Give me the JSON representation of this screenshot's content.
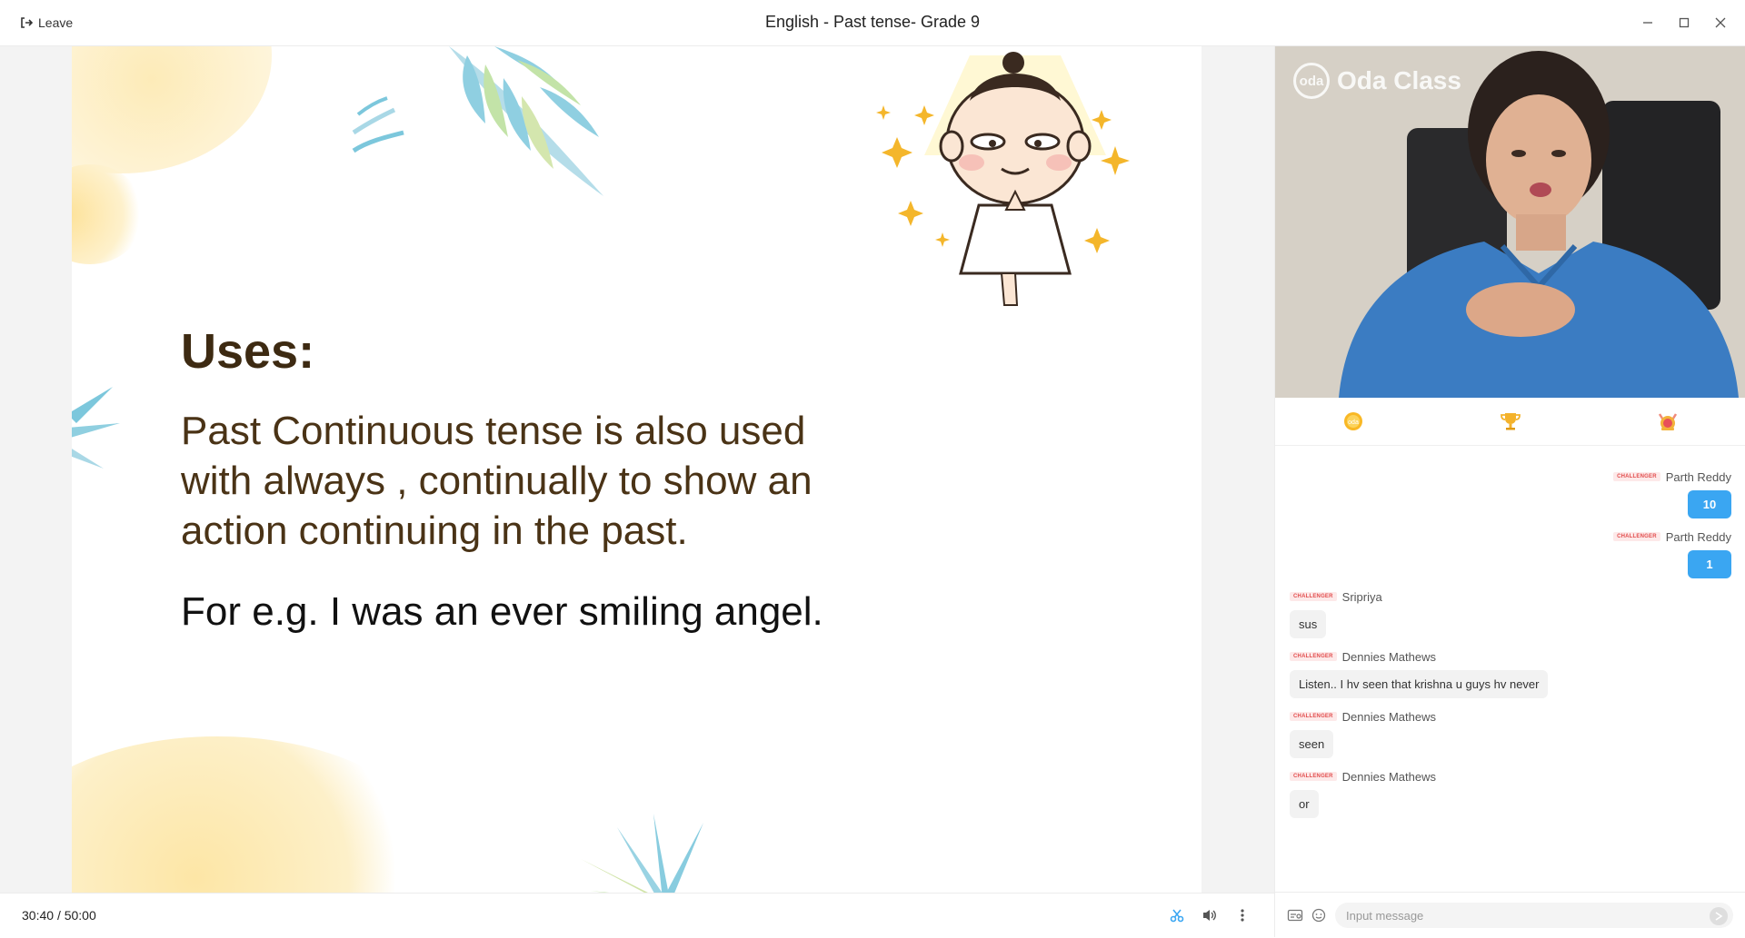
{
  "titlebar": {
    "leave_label": "Leave",
    "title": "English - Past tense- Grade 9"
  },
  "slide": {
    "heading": "Uses:",
    "body": "Past Continuous tense is also used with always , continually to show an action continuing in the past.",
    "example": "For e.g. I was an ever smiling angel."
  },
  "controls": {
    "elapsed": "30:40",
    "separator": "/",
    "total": "50:00"
  },
  "video": {
    "brand_logo": "oda",
    "brand_name": "Oda Class"
  },
  "chat": {
    "badge": "CHALLENGER",
    "messages": [
      {
        "sender": "Parth Reddy",
        "text": "10",
        "side": "right"
      },
      {
        "sender": "Parth Reddy",
        "text": "1",
        "side": "right"
      },
      {
        "sender": "Sripriya",
        "text": "sus",
        "side": "left"
      },
      {
        "sender": "Dennies Mathews",
        "text": "Listen.. I hv seen that krishna u guys hv never",
        "side": "left"
      },
      {
        "sender": "Dennies Mathews",
        "text": "seen",
        "side": "left"
      },
      {
        "sender": "Dennies Mathews",
        "text": "or",
        "side": "left"
      }
    ],
    "input_placeholder": "Input message"
  },
  "colors": {
    "accent_blue": "#3aa6f2",
    "slide_heading": "#3d2a12",
    "badge_red": "#e24e4e",
    "teal_leaf": "#7cc7dc",
    "yellow_blob": "#fde7a8"
  },
  "icons": {
    "leave": "leave-icon",
    "minimize": "minimize-icon",
    "maximize": "maximize-icon",
    "close": "close-icon",
    "scissors": "scissors-icon",
    "volume": "volume-icon",
    "more": "more-vertical-icon",
    "coin": "coin-icon",
    "trophy": "trophy-icon",
    "medal": "medal-icon",
    "screenshot": "screenshot-icon",
    "emoji": "emoji-icon",
    "send": "send-icon"
  }
}
